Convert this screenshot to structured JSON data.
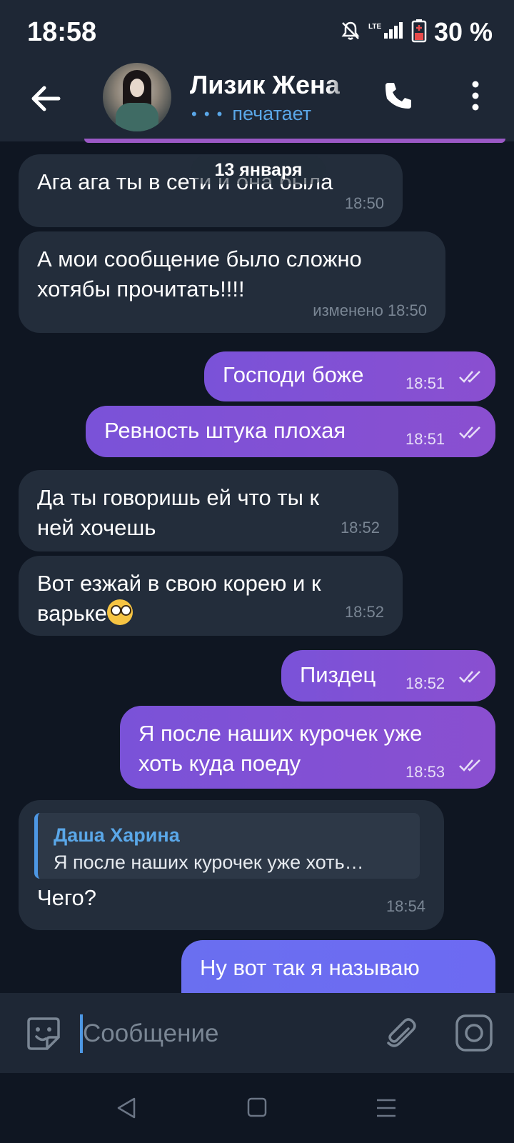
{
  "status_bar": {
    "time": "18:58",
    "network": "LTE",
    "battery_text": "30 %",
    "icons": [
      "mute-icon",
      "signal-icon",
      "battery-icon"
    ]
  },
  "header": {
    "contact_name": "Лизик Жена",
    "status": "печатает",
    "icons": [
      "back-arrow-icon",
      "phone-icon",
      "more-vert-icon"
    ]
  },
  "chat": {
    "date_label": "13 января",
    "messages": [
      {
        "dir": "in",
        "text": "Ага ага ты в сети и она была",
        "time": "18:50"
      },
      {
        "dir": "in",
        "text": "А мои сообщение было сложно хотябы прочитать!!!!",
        "time": "18:50",
        "edited_label": "изменено"
      },
      {
        "dir": "out",
        "text": "Господи боже",
        "time": "18:51",
        "read": true
      },
      {
        "dir": "out",
        "text": "Ревность штука плохая",
        "time": "18:51",
        "read": true
      },
      {
        "dir": "in",
        "text": "Да ты говоришь ей что ты к ней хочешь",
        "time": "18:52"
      },
      {
        "dir": "in",
        "text": "Вот езжай в свою корею и к варьке",
        "emoji": "rolling-eyes-emoji",
        "time": "18:52"
      },
      {
        "dir": "out",
        "text": "Пиздец",
        "time": "18:52",
        "read": true
      },
      {
        "dir": "out",
        "text": "Я после наших курочек уже хоть куда поеду",
        "time": "18:53",
        "read": true
      },
      {
        "dir": "in",
        "reply_to": {
          "name": "Даша Харина",
          "text": "Я после наших курочек уже хоть…"
        },
        "text": "Чего?",
        "time": "18:54"
      },
      {
        "dir": "out",
        "text": "Ну вот так я называю",
        "partial": true
      }
    ]
  },
  "input": {
    "placeholder": "Сообщение",
    "value": "",
    "icons": [
      "sticker-icon",
      "paperclip-icon",
      "camera-icon"
    ]
  },
  "nav": {
    "icons": [
      "nav-back-icon",
      "nav-home-icon",
      "nav-recents-icon"
    ]
  },
  "colors": {
    "background": "#0f1622",
    "header": "#1e2735",
    "incoming_bubble": "#232d3b",
    "outgoing_bubble": "#8a4fd0",
    "accent_blue": "#5aa7e8"
  }
}
